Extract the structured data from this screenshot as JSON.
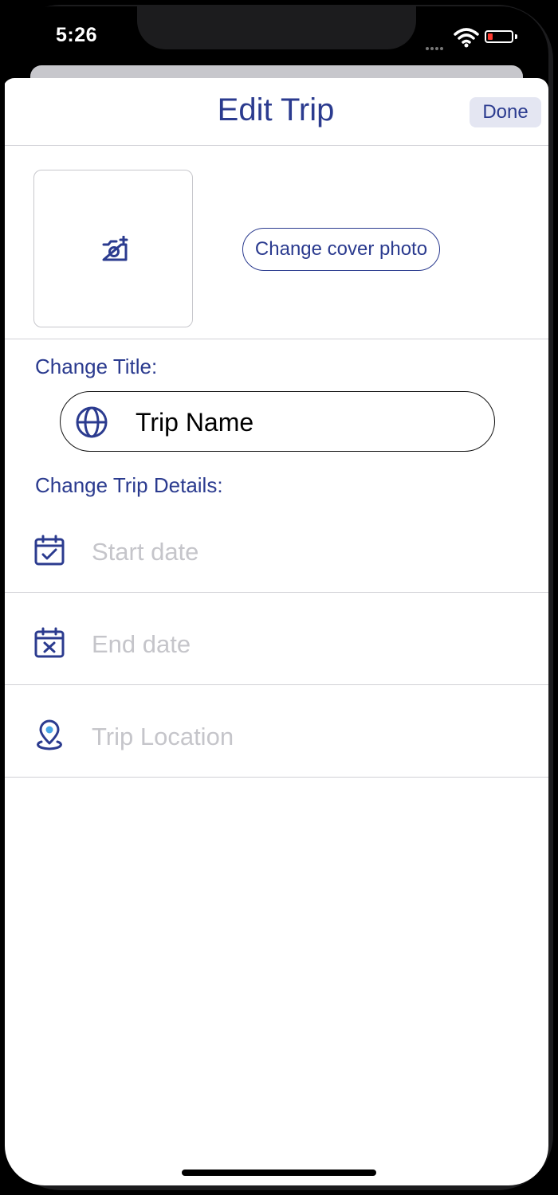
{
  "status_bar": {
    "time": "5:26"
  },
  "nav": {
    "title": "Edit Trip",
    "done_label": "Done"
  },
  "cover": {
    "change_label": "Change cover photo"
  },
  "title_section": {
    "label": "Change Title:",
    "value": "Trip Name"
  },
  "details": {
    "label": "Change Trip Details:",
    "fields": [
      {
        "placeholder": "Start date",
        "icon": "calendar-check-icon"
      },
      {
        "placeholder": "End date",
        "icon": "calendar-x-icon"
      },
      {
        "placeholder": "Trip Location",
        "icon": "location-pin-icon"
      }
    ]
  },
  "colors": {
    "accent": "#2b3b8f",
    "location_dot": "#4aa8e8",
    "placeholder": "#c5c5ca",
    "battery_low": "#ff3b30"
  }
}
